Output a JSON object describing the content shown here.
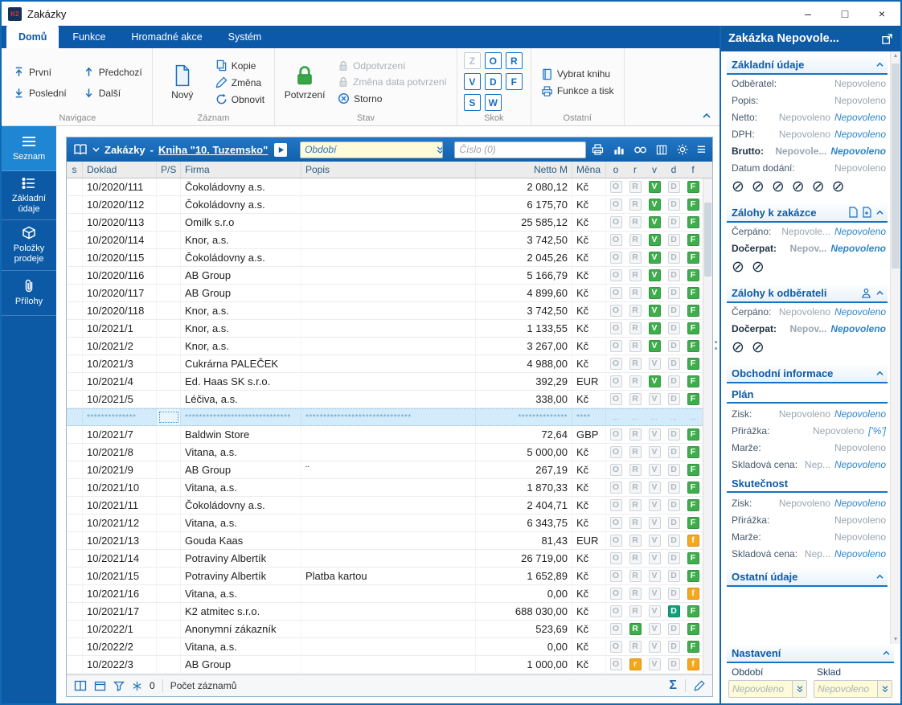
{
  "window": {
    "title": "Zakázky",
    "logo": "K2"
  },
  "ribbon": {
    "tabs": [
      "Domů",
      "Funkce",
      "Hromadné akce",
      "Systém"
    ],
    "groups": {
      "navigace": {
        "label": "Navigace",
        "first": "První",
        "previous": "Předchozí",
        "last": "Poslední",
        "next": "Další"
      },
      "zaznam": {
        "label": "Záznam",
        "novy": "Nový",
        "kopie": "Kopie",
        "zmena": "Změna",
        "obnovit": "Obnovit"
      },
      "stav": {
        "label": "Stav",
        "potvrzeni": "Potvrzení",
        "odpotvrzeni": "Odpotvrzení",
        "zmena_data": "Změna data potvrzení",
        "storno": "Storno"
      },
      "skok": {
        "label": "Skok",
        "letters": [
          {
            "letter": "Z",
            "disabled": true
          },
          {
            "letter": "O"
          },
          {
            "letter": "R"
          },
          {
            "letter": "V"
          },
          {
            "letter": "D"
          },
          {
            "letter": "F"
          },
          {
            "letter": "S"
          },
          {
            "letter": "W"
          }
        ]
      },
      "ostatni": {
        "label": "Ostatní",
        "vybrat_knihu": "Vybrat knihu",
        "funkce_a_tisk": "Funkce a tisk"
      }
    }
  },
  "sidebar": {
    "items": [
      {
        "label": "Seznam",
        "active": true
      },
      {
        "label": "Základní údaje"
      },
      {
        "label": "Položky prodeje"
      },
      {
        "label": "Přílohy"
      }
    ]
  },
  "toolbar": {
    "title": "Zakázky",
    "separator": "-",
    "book_link": "Kniha \"10. Tuzemsko\"",
    "period_placeholder": "Období",
    "search_placeholder": "Číslo (0)"
  },
  "table": {
    "columns": [
      "s",
      "Doklad",
      "P/S",
      "Firma",
      "Popis",
      "Netto M",
      "Měna",
      "o",
      "r",
      "v",
      "d",
      "f"
    ],
    "rows": [
      {
        "doklad": "10/2020/111",
        "firma": "Čokoládovny a.s.",
        "popis": "",
        "netto": "2 080,12",
        "mena": "Kč",
        "flags": [
          [
            "O",
            "off"
          ],
          [
            "R",
            "off"
          ],
          [
            "V",
            "green"
          ],
          [
            "D",
            "off"
          ],
          [
            "F",
            "green"
          ]
        ]
      },
      {
        "doklad": "10/2020/112",
        "firma": "Čokoládovny a.s.",
        "popis": "",
        "netto": "6 175,70",
        "mena": "Kč",
        "flags": [
          [
            "O",
            "off"
          ],
          [
            "R",
            "off"
          ],
          [
            "V",
            "green"
          ],
          [
            "D",
            "off"
          ],
          [
            "F",
            "green"
          ]
        ]
      },
      {
        "doklad": "10/2020/113",
        "firma": "Omilk s.r.o",
        "popis": "",
        "netto": "25 585,12",
        "mena": "Kč",
        "flags": [
          [
            "O",
            "off"
          ],
          [
            "R",
            "off"
          ],
          [
            "V",
            "green"
          ],
          [
            "D",
            "off"
          ],
          [
            "F",
            "green"
          ]
        ]
      },
      {
        "doklad": "10/2020/114",
        "firma": "Knor, a.s.",
        "popis": "",
        "netto": "3 742,50",
        "mena": "Kč",
        "flags": [
          [
            "O",
            "off"
          ],
          [
            "R",
            "off"
          ],
          [
            "V",
            "green"
          ],
          [
            "D",
            "off"
          ],
          [
            "F",
            "green"
          ]
        ]
      },
      {
        "doklad": "10/2020/115",
        "firma": "Čokoládovny a.s.",
        "popis": "",
        "netto": "2 045,26",
        "mena": "Kč",
        "flags": [
          [
            "O",
            "off"
          ],
          [
            "R",
            "off"
          ],
          [
            "V",
            "green"
          ],
          [
            "D",
            "off"
          ],
          [
            "F",
            "green"
          ]
        ]
      },
      {
        "doklad": "10/2020/116",
        "firma": "AB Group",
        "popis": "",
        "netto": "5 166,79",
        "mena": "Kč",
        "flags": [
          [
            "O",
            "off"
          ],
          [
            "R",
            "off"
          ],
          [
            "V",
            "green"
          ],
          [
            "D",
            "off"
          ],
          [
            "F",
            "green"
          ]
        ]
      },
      {
        "doklad": "10/2020/117",
        "firma": "AB Group",
        "popis": "",
        "netto": "4 899,60",
        "mena": "Kč",
        "flags": [
          [
            "O",
            "off"
          ],
          [
            "R",
            "off"
          ],
          [
            "V",
            "green"
          ],
          [
            "D",
            "off"
          ],
          [
            "F",
            "green"
          ]
        ]
      },
      {
        "doklad": "10/2020/118",
        "firma": "Knor, a.s.",
        "popis": "",
        "netto": "3 742,50",
        "mena": "Kč",
        "flags": [
          [
            "O",
            "off"
          ],
          [
            "R",
            "off"
          ],
          [
            "V",
            "green"
          ],
          [
            "D",
            "off"
          ],
          [
            "F",
            "green"
          ]
        ]
      },
      {
        "doklad": "10/2021/1",
        "firma": "Knor, a.s.",
        "popis": "",
        "netto": "1 133,55",
        "mena": "Kč",
        "flags": [
          [
            "O",
            "off"
          ],
          [
            "R",
            "off"
          ],
          [
            "V",
            "green"
          ],
          [
            "D",
            "off"
          ],
          [
            "F",
            "green"
          ]
        ]
      },
      {
        "doklad": "10/2021/2",
        "firma": "Knor, a.s.",
        "popis": "",
        "netto": "3 267,00",
        "mena": "Kč",
        "flags": [
          [
            "O",
            "off"
          ],
          [
            "R",
            "off"
          ],
          [
            "V",
            "green"
          ],
          [
            "D",
            "off"
          ],
          [
            "F",
            "green"
          ]
        ]
      },
      {
        "doklad": "10/2021/3",
        "firma": "Cukrárna PALEČEK",
        "popis": "",
        "netto": "4 988,00",
        "mena": "Kč",
        "flags": [
          [
            "O",
            "off"
          ],
          [
            "R",
            "off"
          ],
          [
            "V",
            "off"
          ],
          [
            "D",
            "off"
          ],
          [
            "F",
            "green"
          ]
        ]
      },
      {
        "doklad": "10/2021/4",
        "firma": "Ed. Haas SK s.r.o.",
        "popis": "",
        "netto": "392,29",
        "mena": "EUR",
        "flags": [
          [
            "O",
            "off"
          ],
          [
            "R",
            "off"
          ],
          [
            "V",
            "green"
          ],
          [
            "D",
            "off"
          ],
          [
            "F",
            "green"
          ]
        ]
      },
      {
        "doklad": "10/2021/5",
        "firma": "Léčiva, a.s.",
        "popis": "",
        "netto": "338,00",
        "mena": "Kč",
        "flags": [
          [
            "O",
            "off"
          ],
          [
            "R",
            "off"
          ],
          [
            "V",
            "off"
          ],
          [
            "D",
            "off"
          ],
          [
            "F",
            "green"
          ]
        ]
      },
      {
        "selected": true,
        "doklad": "**************",
        "firma": "******************************",
        "popis": "******************************",
        "netto": "**************",
        "mena": "****",
        "flags": [
          [
            "…",
            "dots"
          ],
          [
            "…",
            "dots"
          ],
          [
            "…",
            "dots"
          ],
          [
            "…",
            "dots"
          ],
          [
            "…",
            "dots"
          ]
        ]
      },
      {
        "doklad": "10/2021/7",
        "firma": "Baldwin Store",
        "popis": "",
        "netto": "72,64",
        "mena": "GBP",
        "flags": [
          [
            "O",
            "off"
          ],
          [
            "R",
            "off"
          ],
          [
            "V",
            "off"
          ],
          [
            "D",
            "off"
          ],
          [
            "F",
            "green"
          ]
        ]
      },
      {
        "doklad": "10/2021/8",
        "firma": "Vitana, a.s.",
        "popis": "",
        "netto": "5 000,00",
        "mena": "Kč",
        "flags": [
          [
            "O",
            "off"
          ],
          [
            "R",
            "off"
          ],
          [
            "V",
            "off"
          ],
          [
            "D",
            "off"
          ],
          [
            "F",
            "green"
          ]
        ]
      },
      {
        "doklad": "10/2021/9",
        "firma": "AB Group",
        "popis": "¨",
        "netto": "267,19",
        "mena": "Kč",
        "flags": [
          [
            "O",
            "off"
          ],
          [
            "R",
            "off"
          ],
          [
            "V",
            "off"
          ],
          [
            "D",
            "off"
          ],
          [
            "F",
            "green"
          ]
        ]
      },
      {
        "doklad": "10/2021/10",
        "firma": "Vitana, a.s.",
        "popis": "",
        "netto": "1 870,33",
        "mena": "Kč",
        "flags": [
          [
            "O",
            "off"
          ],
          [
            "R",
            "off"
          ],
          [
            "V",
            "off"
          ],
          [
            "D",
            "off"
          ],
          [
            "F",
            "green"
          ]
        ]
      },
      {
        "doklad": "10/2021/11",
        "firma": "Čokoládovny a.s.",
        "popis": "",
        "netto": "2 404,71",
        "mena": "Kč",
        "flags": [
          [
            "O",
            "off"
          ],
          [
            "R",
            "off"
          ],
          [
            "V",
            "off"
          ],
          [
            "D",
            "off"
          ],
          [
            "F",
            "green"
          ]
        ]
      },
      {
        "doklad": "10/2021/12",
        "firma": "Vitana, a.s.",
        "popis": "",
        "netto": "6 343,75",
        "mena": "Kč",
        "flags": [
          [
            "O",
            "off"
          ],
          [
            "R",
            "off"
          ],
          [
            "V",
            "off"
          ],
          [
            "D",
            "off"
          ],
          [
            "F",
            "green"
          ]
        ]
      },
      {
        "doklad": "10/2021/13",
        "firma": "Gouda Kaas",
        "popis": "",
        "netto": "81,43",
        "mena": "EUR",
        "flags": [
          [
            "O",
            "off"
          ],
          [
            "R",
            "off"
          ],
          [
            "V",
            "off"
          ],
          [
            "D",
            "off"
          ],
          [
            "f",
            "orange"
          ]
        ]
      },
      {
        "doklad": "10/2021/14",
        "firma": "Potraviny Albertík",
        "popis": "",
        "netto": "26 719,00",
        "mena": "Kč",
        "flags": [
          [
            "O",
            "off"
          ],
          [
            "R",
            "off"
          ],
          [
            "V",
            "off"
          ],
          [
            "D",
            "off"
          ],
          [
            "F",
            "green"
          ]
        ]
      },
      {
        "doklad": "10/2021/15",
        "firma": "Potraviny Albertík",
        "popis": "Platba kartou",
        "netto": "1 652,89",
        "mena": "Kč",
        "flags": [
          [
            "O",
            "off"
          ],
          [
            "R",
            "off"
          ],
          [
            "V",
            "off"
          ],
          [
            "D",
            "off"
          ],
          [
            "F",
            "green"
          ]
        ]
      },
      {
        "doklad": "10/2021/16",
        "firma": "Vitana, a.s.",
        "popis": "",
        "netto": "0,00",
        "mena": "Kč",
        "flags": [
          [
            "O",
            "off"
          ],
          [
            "R",
            "off"
          ],
          [
            "V",
            "off"
          ],
          [
            "D",
            "off"
          ],
          [
            "f",
            "orange"
          ]
        ]
      },
      {
        "doklad": "10/2021/17",
        "firma": "K2 atmitec s.r.o.",
        "popis": "",
        "netto": "688 030,00",
        "mena": "Kč",
        "flags": [
          [
            "O",
            "off"
          ],
          [
            "R",
            "off"
          ],
          [
            "V",
            "off"
          ],
          [
            "D",
            "teal"
          ],
          [
            "F",
            "green"
          ]
        ]
      },
      {
        "doklad": "10/2022/1",
        "firma": "Anonymní zákazník",
        "popis": "",
        "netto": "523,69",
        "mena": "Kč",
        "flags": [
          [
            "O",
            "off"
          ],
          [
            "R",
            "green"
          ],
          [
            "V",
            "off"
          ],
          [
            "D",
            "off"
          ],
          [
            "F",
            "green"
          ]
        ]
      },
      {
        "doklad": "10/2022/2",
        "firma": "Vitana, a.s.",
        "popis": "",
        "netto": "0,00",
        "mena": "Kč",
        "flags": [
          [
            "O",
            "off"
          ],
          [
            "R",
            "off"
          ],
          [
            "V",
            "off"
          ],
          [
            "D",
            "off"
          ],
          [
            "F",
            "green"
          ]
        ]
      },
      {
        "doklad": "10/2022/3",
        "firma": "AB Group",
        "popis": "",
        "netto": "1 000,00",
        "mena": "Kč",
        "flags": [
          [
            "O",
            "off"
          ],
          [
            "r",
            "orange"
          ],
          [
            "V",
            "off"
          ],
          [
            "D",
            "off"
          ],
          [
            "f",
            "orange"
          ]
        ]
      }
    ]
  },
  "statusbar": {
    "count": "0",
    "records_label": "Počet záznamů"
  },
  "right_panel": {
    "title": "Zakázka Nepovole...",
    "sections": {
      "zakladni": {
        "title": "Základní údaje",
        "fields": [
          {
            "label": "Odběratel:",
            "value": "Nepovoleno"
          },
          {
            "label": "Popis:",
            "value": "Nepovoleno"
          },
          {
            "label": "Netto:",
            "value": "Nepovoleno",
            "value2": "Nepovoleno"
          },
          {
            "label": "DPH:",
            "value": "Nepovoleno",
            "value2": "Nepovoleno"
          },
          {
            "label": "Brutto:",
            "value": "Nepovole...",
            "value2": "Nepovoleno",
            "bold": true
          },
          {
            "label": "Datum dodání:",
            "value": "Nepovoleno"
          }
        ],
        "deny_count": 6
      },
      "zalohy_zakazka": {
        "title": "Zálohy k zakázce",
        "fields": [
          {
            "label": "Čerpáno:",
            "value": "Nepovole...",
            "value2": "Nepovoleno"
          },
          {
            "label": "Dočerpat:",
            "value": "Nepov...",
            "value2": "Nepovoleno",
            "bold": true
          }
        ],
        "deny_count": 2
      },
      "zalohy_odberatel": {
        "title": "Zálohy k odběrateli",
        "fields": [
          {
            "label": "Čerpáno:",
            "value": "Nepovoleno",
            "value2": "Nepovoleno"
          },
          {
            "label": "Dočerpat:",
            "value": "Nepov...",
            "value2": "Nepovoleno",
            "bold": true
          }
        ],
        "deny_count": 2
      },
      "obchodni": {
        "title": "Obchodní informace",
        "plan": {
          "title": "Plán",
          "fields": [
            {
              "label": "Zisk:",
              "value": "Nepovoleno",
              "value2": "Nepovoleno"
            },
            {
              "label": "Přirážka:",
              "value": "Nepovoleno",
              "value2": "['%']"
            },
            {
              "label": "Marže:",
              "value": "Nepovoleno"
            },
            {
              "label": "Skladová cena:",
              "value": "Nep...",
              "value2": "Nepovoleno"
            }
          ]
        },
        "skutecnost": {
          "title": "Skutečnost",
          "fields": [
            {
              "label": "Zisk:",
              "value": "Nepovoleno",
              "value2": "Nepovoleno"
            },
            {
              "label": "Přirážka:",
              "value": "Nepovoleno"
            },
            {
              "label": "Marže:",
              "value": "Nepovoleno"
            },
            {
              "label": "Skladová cena:",
              "value": "Nep...",
              "value2": "Nepovoleno"
            }
          ]
        }
      },
      "ostatni": {
        "title": "Ostatní údaje"
      },
      "nastaveni": {
        "title": "Nastavení",
        "obdobi_label": "Období",
        "sklad_label": "Sklad",
        "obdobi_value": "Nepovoleno",
        "sklad_value": "Nepovoleno"
      }
    }
  }
}
